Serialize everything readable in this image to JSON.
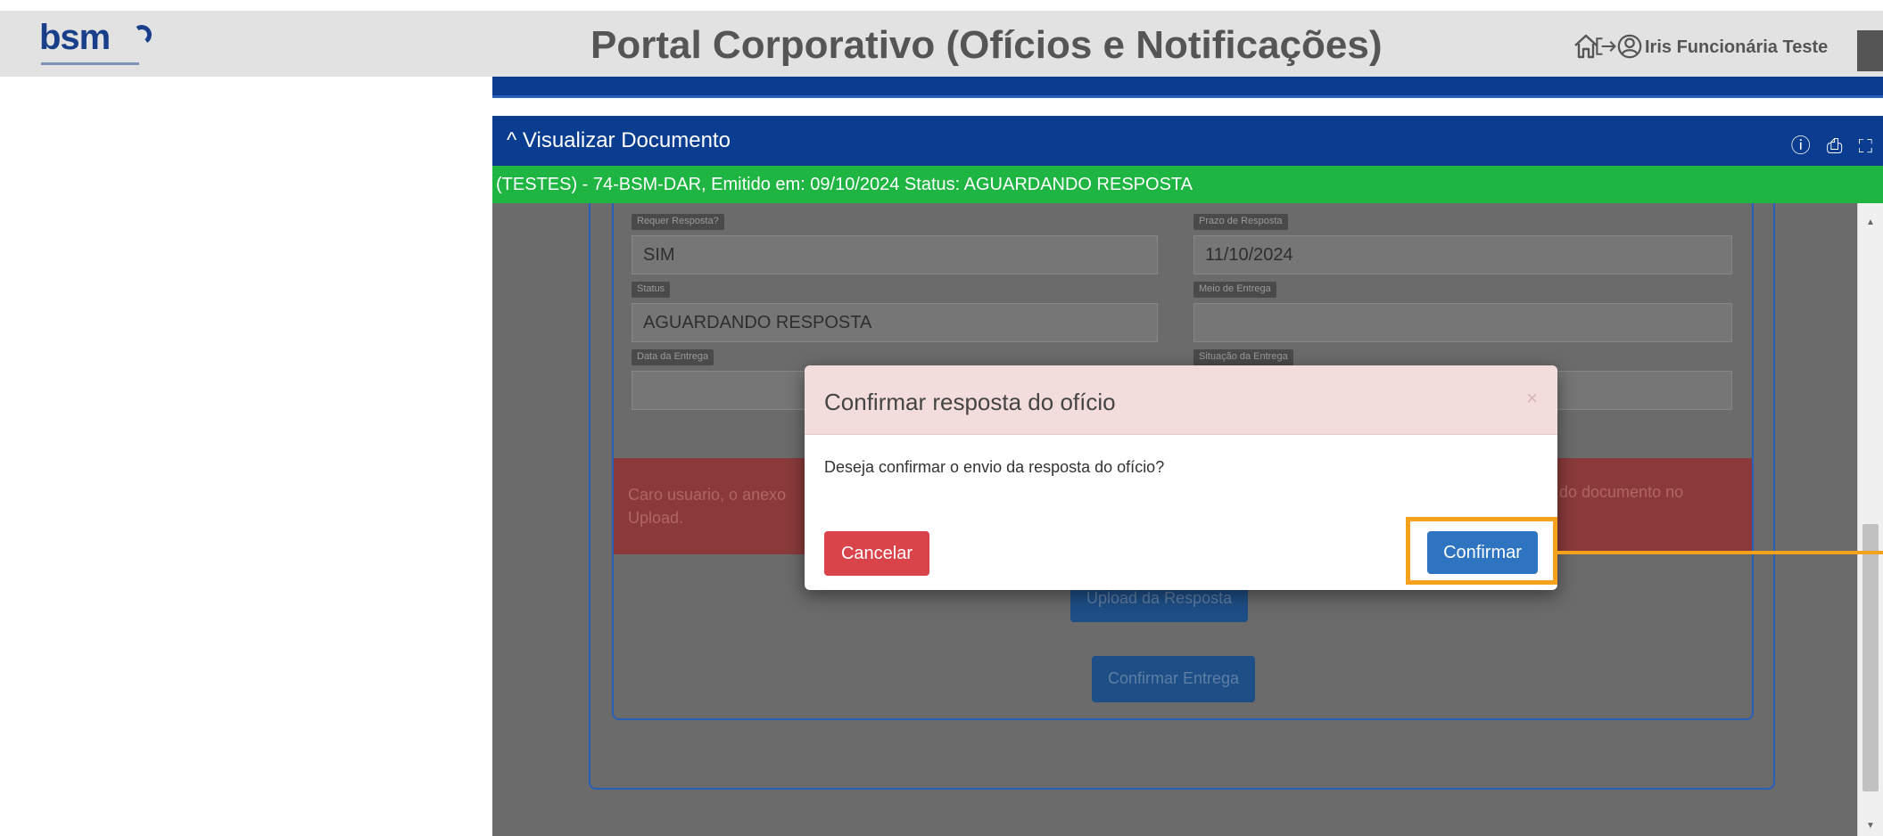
{
  "header": {
    "logo_text": "bsm",
    "title": "Portal Corporativo (Ofícios e Notificações)",
    "user_name": "Iris Funcionária Teste"
  },
  "panel": {
    "title": "^ Visualizar Documento",
    "tools": "ⓘ ⎙ ⛶",
    "status": "(TESTES) - 74-BSM-DAR, Emitido em: 09/10/2024 Status: AGUARDANDO RESPOSTA"
  },
  "form": {
    "requer_resposta_label": "Requer Resposta?",
    "requer_resposta_value": "SIM",
    "prazo_resposta_label": "Prazo de Resposta",
    "prazo_resposta_value": "11/10/2024",
    "status_label": "Status",
    "status_value": "AGUARDANDO RESPOSTA",
    "meio_entrega_label": "Meio de Entrega",
    "meio_entrega_value": "",
    "data_entrega_label": "Data da Entrega",
    "data_entrega_value": "",
    "situacao_entrega_label": "Situação da Entrega",
    "situacao_entrega_value": ""
  },
  "alert": {
    "text_left": "Caro usuario, o anexo Upload.",
    "text_right": "do documento no"
  },
  "background_buttons": {
    "upload": "Upload da Resposta",
    "confirm_delivery": "Confirmar Entrega"
  },
  "modal": {
    "title": "Confirmar resposta do ofício",
    "close": "×",
    "body": "Deseja confirmar o envio da resposta do ofício?",
    "cancel": "Cancelar",
    "confirm": "Confirmar"
  },
  "colors": {
    "header_bg": "#e2e2e2",
    "panel_blue": "#0a3d8f",
    "status_green": "#1fb542",
    "cancel_red": "#d9434a",
    "confirm_blue": "#2e74c0",
    "highlight_orange": "#f4a21c"
  },
  "icons": [
    "home-icon",
    "logout-icon",
    "user-circle-icon",
    "info-icon",
    "print-icon",
    "fullscreen-icon"
  ]
}
